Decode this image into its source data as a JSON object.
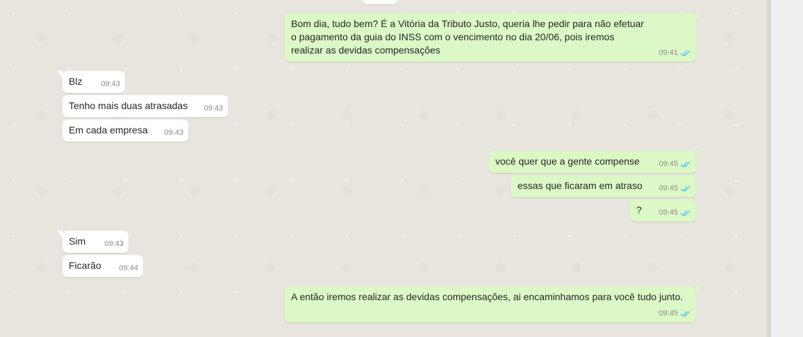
{
  "messages": [
    {
      "direction": "out",
      "text": "Bom dia, tudo bem? É a Vitória da Tributo Justo, queria lhe pedir para não efetuar o pagamento da guia do INSS com o vencimento no dia 20/06, pois iremos realizar as devidas compensações",
      "time": "09:41",
      "status": "read"
    },
    {
      "direction": "in",
      "text": "Blz",
      "time": "09:43"
    },
    {
      "direction": "in",
      "text": "Tenho mais duas atrasadas",
      "time": "09:43"
    },
    {
      "direction": "in",
      "text": "Em cada empresa",
      "time": "09:43"
    },
    {
      "direction": "out",
      "text": "você quer que a gente compense",
      "time": "09:45",
      "status": "read"
    },
    {
      "direction": "out",
      "text": "essas que ficaram em atraso",
      "time": "09:45",
      "status": "read"
    },
    {
      "direction": "out",
      "text": "?",
      "time": "09:45",
      "status": "read"
    },
    {
      "direction": "in",
      "text": "Sim",
      "time": "09:43"
    },
    {
      "direction": "in",
      "text": "Ficarão",
      "time": "09:44"
    },
    {
      "direction": "out",
      "text": "A então iremos realizar as devidas compensações, ai encaminhamos para você tudo junto.",
      "time": "09:45",
      "status": "read"
    }
  ],
  "icons": {
    "read_receipt": "double-check-icon"
  },
  "colors": {
    "outgoing_bubble": "#dcf8c6",
    "incoming_bubble": "#ffffff",
    "read_ticks": "#4fc3f7",
    "background": "#e8e4de"
  }
}
